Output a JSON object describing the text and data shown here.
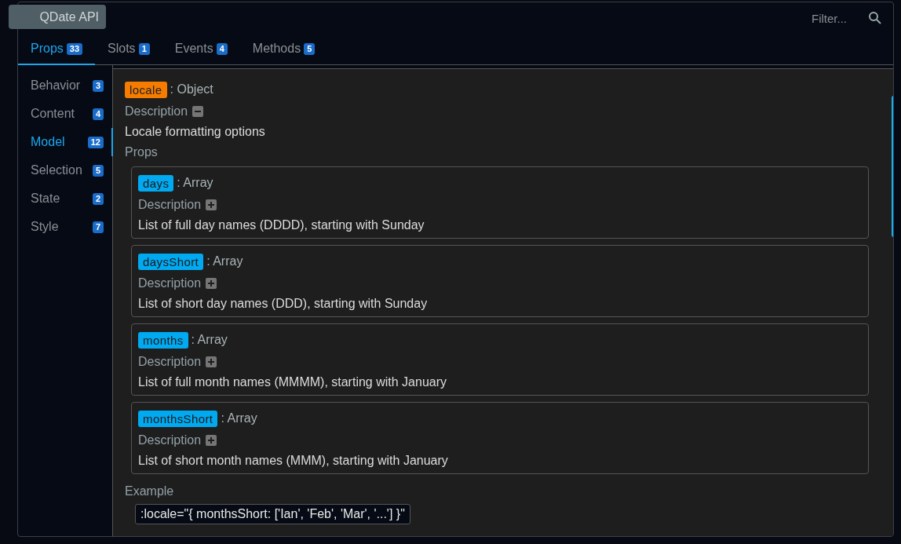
{
  "title": "QDate API",
  "filter": {
    "placeholder": "Filter..."
  },
  "tabs": [
    {
      "label": "Props",
      "count": "33",
      "selected": true
    },
    {
      "label": "Slots",
      "count": "1",
      "selected": false
    },
    {
      "label": "Events",
      "count": "4",
      "selected": false
    },
    {
      "label": "Methods",
      "count": "5",
      "selected": false
    }
  ],
  "sidebar": {
    "items": [
      {
        "label": "Behavior",
        "count": "3",
        "selected": false
      },
      {
        "label": "Content",
        "count": "4",
        "selected": false
      },
      {
        "label": "Model",
        "count": "12",
        "selected": true
      },
      {
        "label": "Selection",
        "count": "5",
        "selected": false
      },
      {
        "label": "State",
        "count": "2",
        "selected": false
      },
      {
        "label": "Style",
        "count": "7",
        "selected": false
      }
    ]
  },
  "prop": {
    "name": "locale",
    "type": ": Object",
    "description_label": "Description",
    "expanded": true,
    "description": "Locale formatting options",
    "props_label": "Props",
    "children": [
      {
        "name": "days",
        "type": ": Array",
        "description_label": "Description",
        "expanded": false,
        "description": "List of full day names (DDDD), starting with Sunday"
      },
      {
        "name": "daysShort",
        "type": ": Array",
        "description_label": "Description",
        "expanded": false,
        "description": "List of short day names (DDD), starting with Sunday"
      },
      {
        "name": "months",
        "type": ": Array",
        "description_label": "Description",
        "expanded": false,
        "description": "List of full month names (MMMM), starting with January"
      },
      {
        "name": "monthsShort",
        "type": ": Array",
        "description_label": "Description",
        "expanded": false,
        "description": "List of short month names (MMM), starting with January"
      }
    ],
    "example_label": "Example",
    "example": ":locale=\"{ monthsShort: ['Ian', 'Feb', 'Mar', '...'] }\""
  }
}
